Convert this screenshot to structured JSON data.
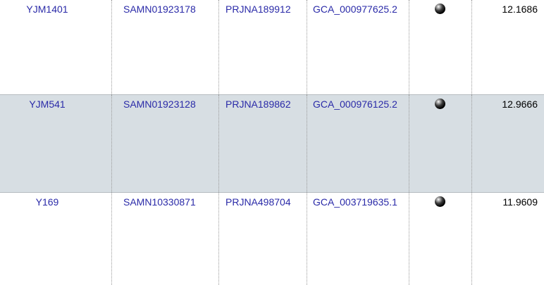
{
  "rows": [
    {
      "strain": "YJM1401",
      "biosample": "SAMN01923178",
      "bioproject": "PRJNA189912",
      "assembly": "GCA_000977625.2",
      "marker_icon": "black-sphere-icon",
      "value": "12.1686"
    },
    {
      "strain": "YJM541",
      "biosample": "SAMN01923128",
      "bioproject": "PRJNA189862",
      "assembly": "GCA_000976125.2",
      "marker_icon": "black-sphere-icon",
      "value": "12.9666"
    },
    {
      "strain": "Y169",
      "biosample": "SAMN10330871",
      "bioproject": "PRJNA498704",
      "assembly": "GCA_003719635.1",
      "marker_icon": "black-sphere-icon",
      "value": "11.9609"
    }
  ],
  "colors": {
    "link": "#2a2aa8",
    "highlight_row": "#d7dee3",
    "text": "#000000"
  }
}
